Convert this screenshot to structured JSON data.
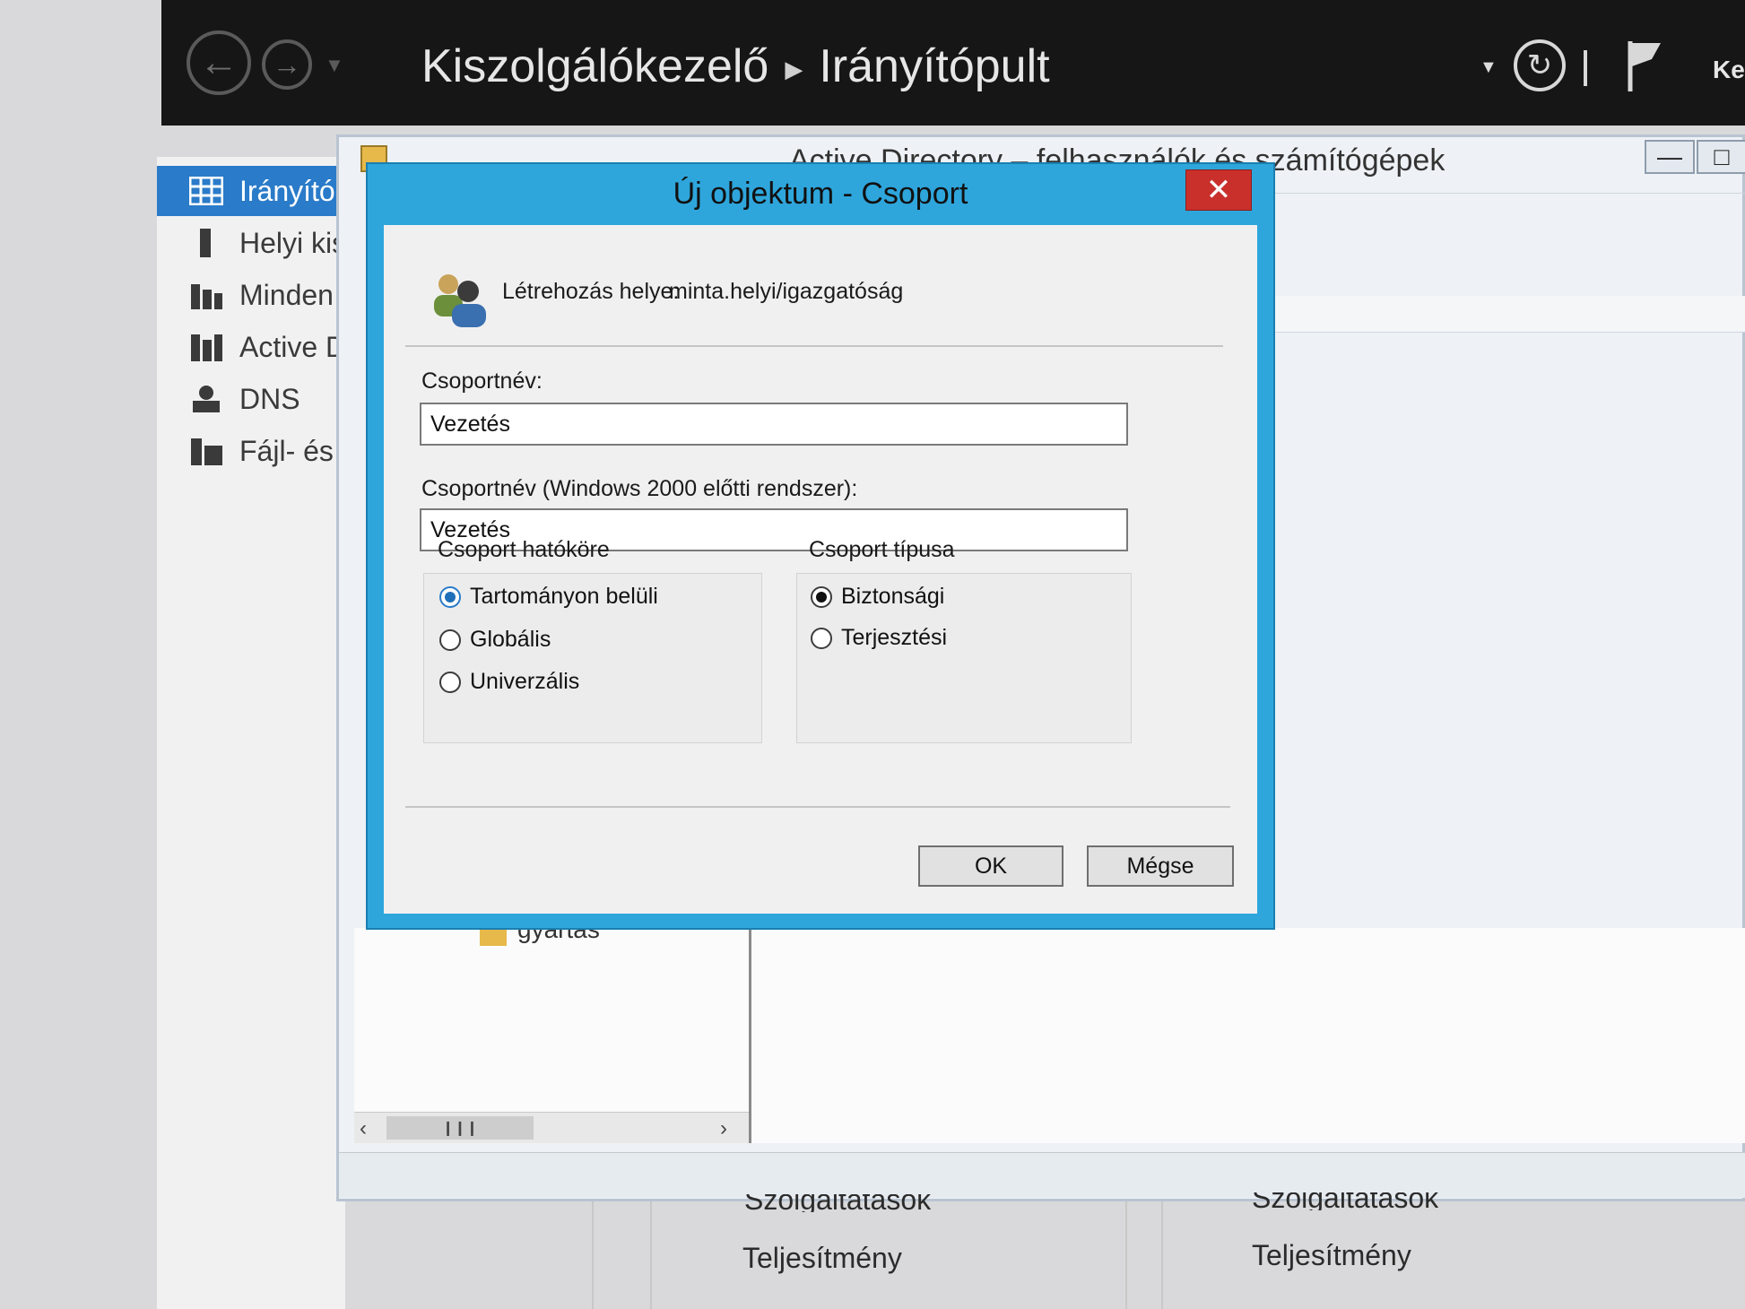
{
  "server_manager": {
    "breadcrumb_app": "Kiszolgálókezelő",
    "breadcrumb_page": "Irányítópult",
    "manage_menu_cut": "Ke",
    "nav_items": [
      {
        "label": "Irányító",
        "icon": "dashboard-icon",
        "active": true
      },
      {
        "label": "Helyi kis",
        "icon": "server-icon",
        "active": false
      },
      {
        "label": "Minden",
        "icon": "servers-icon",
        "active": false
      },
      {
        "label": "Active D",
        "icon": "active-directory-icon",
        "active": false
      },
      {
        "label": "DNS",
        "icon": "dns-icon",
        "active": false
      },
      {
        "label": "Fájl- és",
        "icon": "file-services-icon",
        "active": false
      }
    ]
  },
  "aduc_window": {
    "title": "Active Directory – felhasználók és számítógépek",
    "tree_item": "gyártás"
  },
  "dialog": {
    "title": "Új objektum - Csoport",
    "close_glyph": "✕",
    "create_in_label": "Létrehozás helye:",
    "create_in_value": "minta.helyi/igazgatóság",
    "group_name_label": "Csoportnév:",
    "group_name_value": "Vezetés",
    "pre2000_label": "Csoportnév (Windows 2000 előtti rendszer):",
    "pre2000_value": "Vezetés",
    "scope": {
      "title": "Csoport hatóköre",
      "options": [
        "Tartományon belüli",
        "Globális",
        "Univerzális"
      ],
      "selected": "Tartományon belüli"
    },
    "type": {
      "title": "Csoport típusa",
      "options": [
        "Biztonsági",
        "Terjesztési"
      ],
      "selected": "Biztonsági"
    },
    "ok_label": "OK",
    "cancel_label": "Mégse"
  },
  "dashboard_tiles": {
    "left_top_cut": "Szolgáltatások",
    "left_perf": "Teljesítmény",
    "right_top_cut": "Szolgáltatások",
    "right_perf": "Teljesítmény"
  }
}
